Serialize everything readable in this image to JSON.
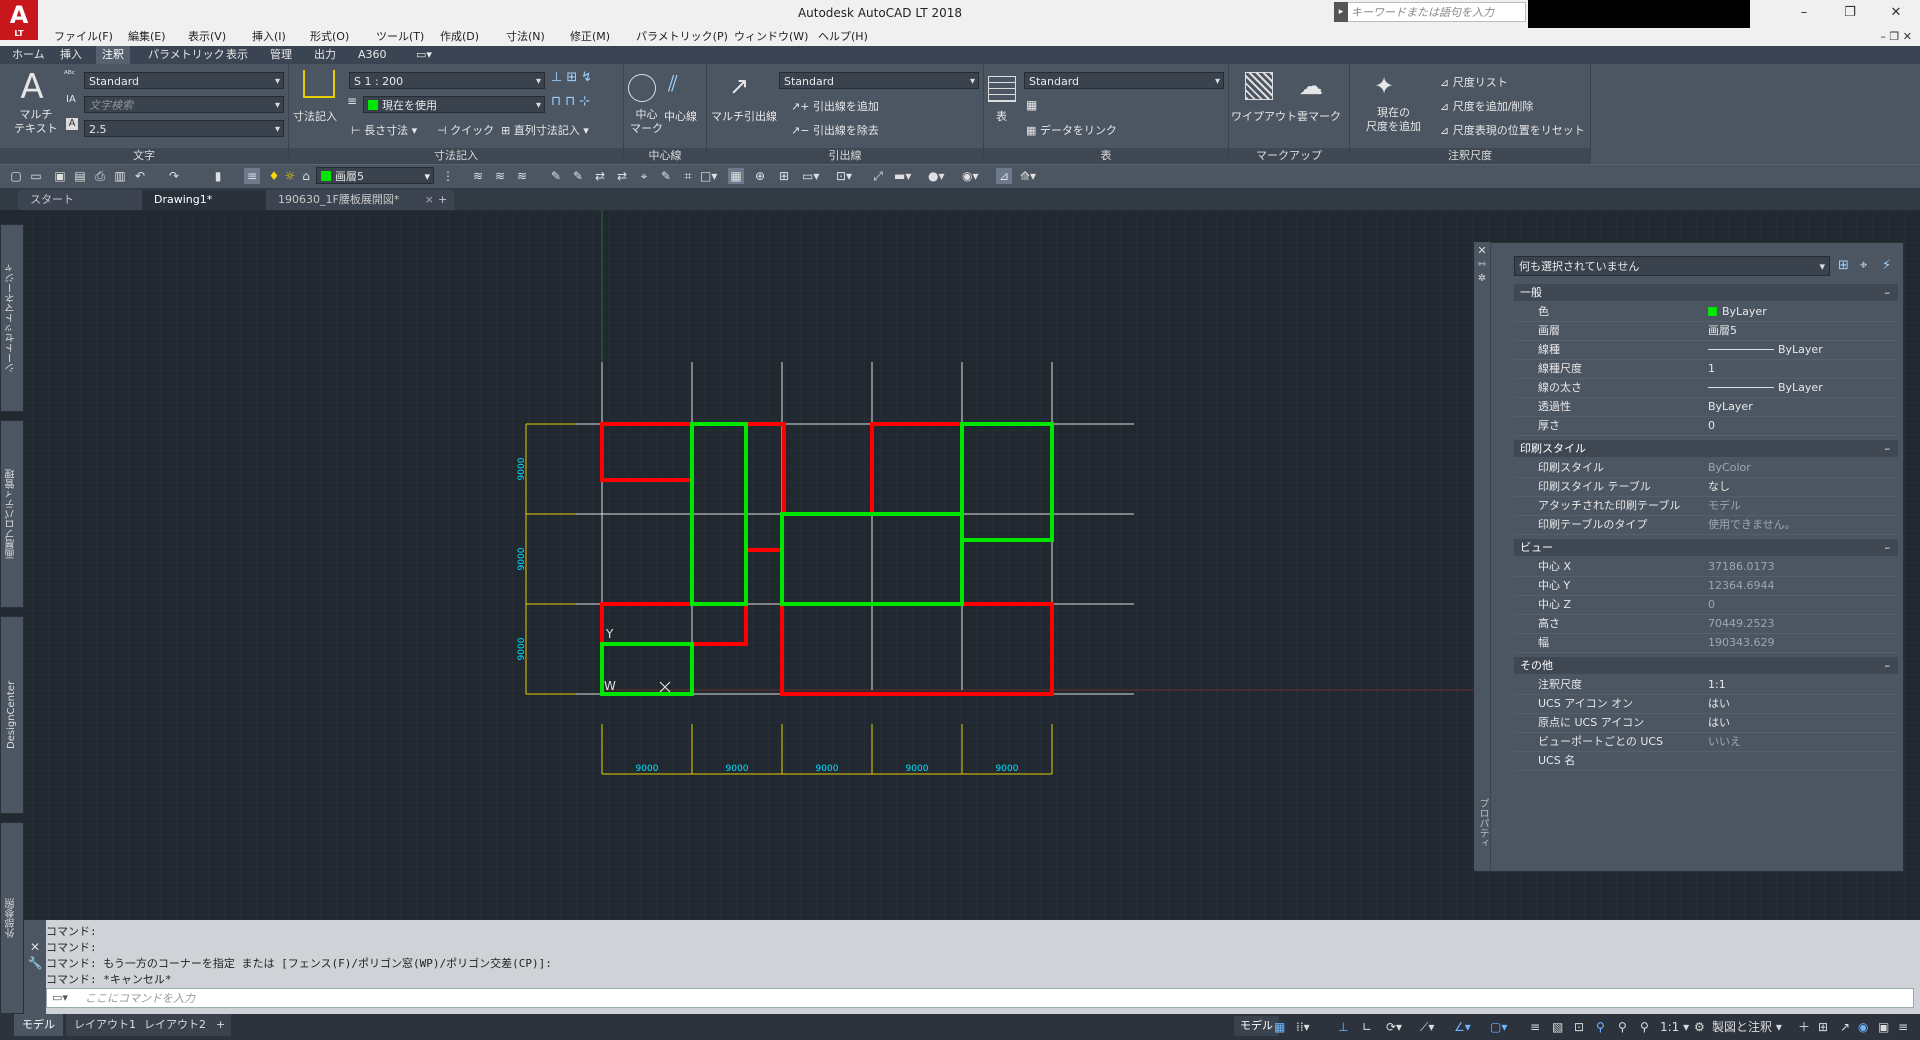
{
  "window": {
    "title": "Autodesk AutoCAD LT 2018",
    "logo_text": "A",
    "logo_sub": "LT",
    "search_placeholder": "キーワードまたは語句を入力",
    "controls": [
      "–",
      "❐",
      "✕"
    ]
  },
  "menu": [
    "ファイル(F)",
    "編集(E)",
    "表示(V)",
    "挿入(I)",
    "形式(O)",
    "ツール(T)",
    "作成(D)",
    "寸法(N)",
    "修正(M)",
    "パラメトリック(P)",
    "ウィンドウ(W)",
    "ヘルプ(H)"
  ],
  "ribbon_tabs": [
    "ホーム",
    "挿入",
    "注釈",
    "パラメトリック",
    "表示",
    "管理",
    "出力",
    "A360"
  ],
  "ribbon_active_tab": "注釈",
  "ribbon": {
    "text_panel": {
      "title": "文字",
      "multiline_label": "マルチ\nテキスト",
      "style": "Standard",
      "search_placeholder": "文字検索",
      "height": "2.5"
    },
    "dim_panel": {
      "title": "寸法記入",
      "big_label": "寸法記入",
      "scale": "S 1 : 200",
      "layer": "現在を使用",
      "linear": "長さ寸法",
      "quick": "クイック",
      "continue": "直列寸法記入"
    },
    "center_panel": {
      "title": "中心線",
      "mark": "中心\nマーク",
      "line": "中心線"
    },
    "leader_panel": {
      "title": "引出線",
      "multi": "マルチ引出線",
      "style": "Standard",
      "add": "引出線を追加",
      "remove": "引出線を除去"
    },
    "table_panel": {
      "title": "表",
      "table": "表",
      "style": "Standard",
      "link": "データをリンク"
    },
    "markup_panel": {
      "title": "マークアップ",
      "wipeout": "ワイプアウト",
      "cloud": "雲マーク"
    },
    "scale_panel": {
      "title": "注釈尺度",
      "add_current": "現在の\n尺度を追加",
      "list": "尺度リスト",
      "add_delete": "尺度を追加/削除",
      "reset": "尺度表現の位置をリセット"
    }
  },
  "toolbar_layer": "画層5",
  "file_tabs": [
    {
      "label": "スタート",
      "active": false
    },
    {
      "label": "Drawing1*",
      "active": true
    },
    {
      "label": "190630_1F腰板展開図*",
      "active": false
    }
  ],
  "left_palettes": [
    "シートセットマネージャ",
    "画層プロパティ管理",
    "DesignCenter",
    "外部参照"
  ],
  "drawing": {
    "dimension_values_horizontal": [
      "9000",
      "9000",
      "9000",
      "9000",
      "9000"
    ],
    "dimension_values_vertical": [
      "9000",
      "9000",
      "9000"
    ],
    "ucs_labels": {
      "y": "Y",
      "w": "W"
    },
    "colors": {
      "red": "#ff0000",
      "green": "#00e600",
      "grid": "#e0e0e0",
      "dim": "#e8d000",
      "dimtext": "#00e5ff"
    }
  },
  "properties": {
    "selection": "何も選択されていません",
    "side_label": "プロパティ",
    "sections": [
      {
        "title": "一般",
        "rows": [
          {
            "k": "色",
            "v": "ByLayer",
            "dim": false
          },
          {
            "k": "画層",
            "v": "画層5",
            "dim": false
          },
          {
            "k": "線種",
            "v": "ByLayer",
            "dim": false
          },
          {
            "k": "線種尺度",
            "v": "1",
            "dim": false
          },
          {
            "k": "線の太さ",
            "v": "ByLayer",
            "dim": false
          },
          {
            "k": "透過性",
            "v": "ByLayer",
            "dim": false
          },
          {
            "k": "厚さ",
            "v": "0",
            "dim": false
          }
        ]
      },
      {
        "title": "印刷スタイル",
        "rows": [
          {
            "k": "印刷スタイル",
            "v": "ByColor",
            "dim": true
          },
          {
            "k": "印刷スタイル テーブル",
            "v": "なし",
            "dim": false
          },
          {
            "k": "アタッチされた印刷テーブル",
            "v": "モデル",
            "dim": true
          },
          {
            "k": "印刷テーブルのタイプ",
            "v": "使用できません。",
            "dim": true
          }
        ]
      },
      {
        "title": "ビュー",
        "rows": [
          {
            "k": "中心 X",
            "v": "37186.0173",
            "dim": true
          },
          {
            "k": "中心 Y",
            "v": "12364.6944",
            "dim": true
          },
          {
            "k": "中心 Z",
            "v": "0",
            "dim": true
          },
          {
            "k": "高さ",
            "v": "70449.2523",
            "dim": true
          },
          {
            "k": "幅",
            "v": "190343.629",
            "dim": true
          }
        ]
      },
      {
        "title": "その他",
        "rows": [
          {
            "k": "注釈尺度",
            "v": "1:1",
            "dim": false
          },
          {
            "k": "UCS アイコン オン",
            "v": "はい",
            "dim": false
          },
          {
            "k": "原点に UCS アイコン",
            "v": "はい",
            "dim": false
          },
          {
            "k": "ビューポートごとの UCS",
            "v": "いいえ",
            "dim": true
          },
          {
            "k": "UCS 名",
            "v": "",
            "dim": false
          }
        ]
      }
    ]
  },
  "command": {
    "history": [
      "コマンド:",
      "コマンド:",
      "コマンド: もう一方のコーナーを指定 または [フェンス(F)/ポリゴン窓(WP)/ポリゴン交差(CP)]:",
      "コマンド: *キャンセル*"
    ],
    "placeholder": "ここにコマンドを入力"
  },
  "layout_tabs": [
    "モデル",
    "レイアウト1",
    "レイアウト2"
  ],
  "status": {
    "model": "モデル",
    "scale": "1:1",
    "workspace": "製図と注釈"
  }
}
